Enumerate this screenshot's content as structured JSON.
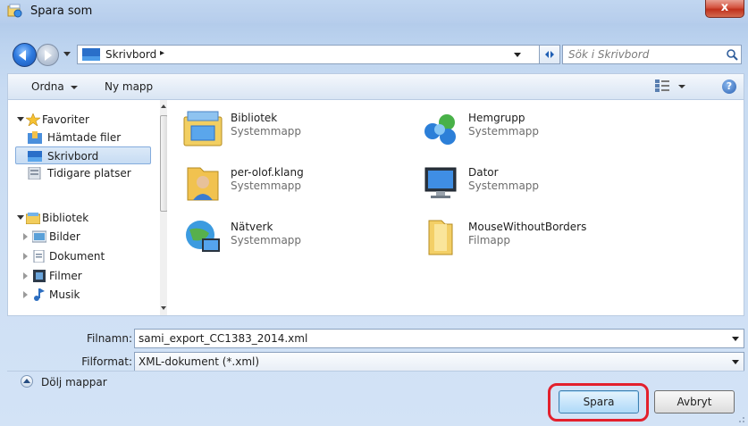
{
  "window": {
    "title": "Spara som",
    "close_label": "x"
  },
  "address_bar": {
    "location": "Skrivbord",
    "separator": "▸"
  },
  "search": {
    "placeholder": "Sök i Skrivbord"
  },
  "toolbar": {
    "organize_label": "Ordna",
    "new_folder_label": "Ny mapp",
    "help_label": "?"
  },
  "nav_pane": {
    "groups": [
      {
        "label": "Favoriter",
        "items": [
          {
            "label": "Hämtade filer",
            "icon": "downloads-icon"
          },
          {
            "label": "Skrivbord",
            "icon": "desktop-icon",
            "selected": true
          },
          {
            "label": "Tidigare platser",
            "icon": "recent-places-icon"
          }
        ]
      },
      {
        "label": "Bibliotek",
        "items": [
          {
            "label": "Bilder",
            "icon": "pictures-icon"
          },
          {
            "label": "Dokument",
            "icon": "documents-icon"
          },
          {
            "label": "Filmer",
            "icon": "videos-icon"
          },
          {
            "label": "Musik",
            "icon": "music-icon"
          }
        ]
      }
    ]
  },
  "files": [
    {
      "name": "Bibliotek",
      "type": "Systemmapp",
      "icon": "libraries-icon"
    },
    {
      "name": "Hemgrupp",
      "type": "Systemmapp",
      "icon": "homegroup-icon"
    },
    {
      "name": "per-olof.klang",
      "type": "Systemmapp",
      "icon": "user-folder-icon"
    },
    {
      "name": "Dator",
      "type": "Systemmapp",
      "icon": "computer-icon"
    },
    {
      "name": "Nätverk",
      "type": "Systemmapp",
      "icon": "network-icon"
    },
    {
      "name": "MouseWithoutBorders",
      "type": "Filmapp",
      "icon": "folder-icon"
    }
  ],
  "form": {
    "filename_label": "Filnamn:",
    "filename_value": "sami_export_CC1383_2014.xml",
    "format_label": "Filformat:",
    "format_value": "XML-dokument (*.xml)"
  },
  "footer": {
    "hide_folders_label": "Dölj mappar",
    "save_label": "Spara",
    "cancel_label": "Avbryt"
  },
  "colors": {
    "highlight": "#e3202d",
    "accent": "#3c7fb1"
  }
}
